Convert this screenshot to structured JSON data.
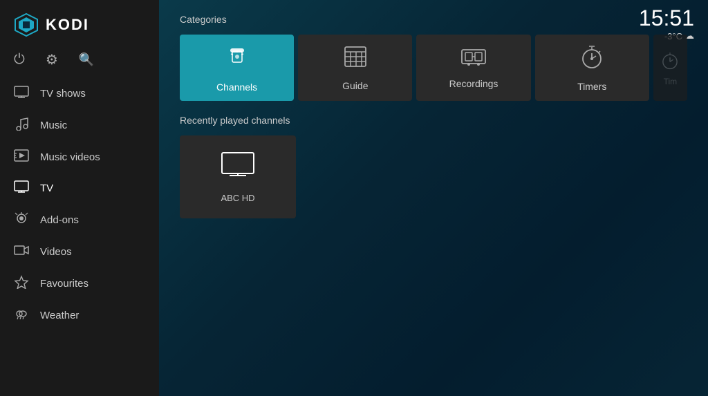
{
  "sidebar": {
    "logo_text": "KODI",
    "actions": [
      {
        "id": "power",
        "icon": "⏻",
        "label": "power-icon"
      },
      {
        "id": "settings",
        "icon": "⚙",
        "label": "settings-icon"
      },
      {
        "id": "search",
        "icon": "🔍",
        "label": "search-icon"
      }
    ],
    "nav_items": [
      {
        "id": "tv-shows",
        "label": "TV shows",
        "icon": "🖥"
      },
      {
        "id": "music",
        "label": "Music",
        "icon": "🎧"
      },
      {
        "id": "music-videos",
        "label": "Music videos",
        "icon": "🎵"
      },
      {
        "id": "tv",
        "label": "TV",
        "icon": "📺",
        "active": true
      },
      {
        "id": "add-ons",
        "label": "Add-ons",
        "icon": "🏷"
      },
      {
        "id": "videos",
        "label": "Videos",
        "icon": "🎬"
      },
      {
        "id": "favourites",
        "label": "Favourites",
        "icon": "⭐"
      },
      {
        "id": "weather",
        "label": "Weather",
        "icon": "🌩"
      }
    ]
  },
  "header": {
    "time": "15:51",
    "temperature": "-3°C",
    "weather_icon": "☁"
  },
  "categories": {
    "title": "Categories",
    "items": [
      {
        "id": "channels",
        "label": "Channels",
        "icon": "remote",
        "active": true
      },
      {
        "id": "guide",
        "label": "Guide",
        "icon": "guide"
      },
      {
        "id": "recordings",
        "label": "Recordings",
        "icon": "recordings"
      },
      {
        "id": "timers",
        "label": "Timers",
        "icon": "timers"
      },
      {
        "id": "timers2",
        "label": "Tim...",
        "icon": "timers2",
        "partial": true
      }
    ]
  },
  "recently_played": {
    "title": "Recently played channels",
    "items": [
      {
        "id": "abc-hd",
        "label": "ABC HD"
      }
    ]
  }
}
